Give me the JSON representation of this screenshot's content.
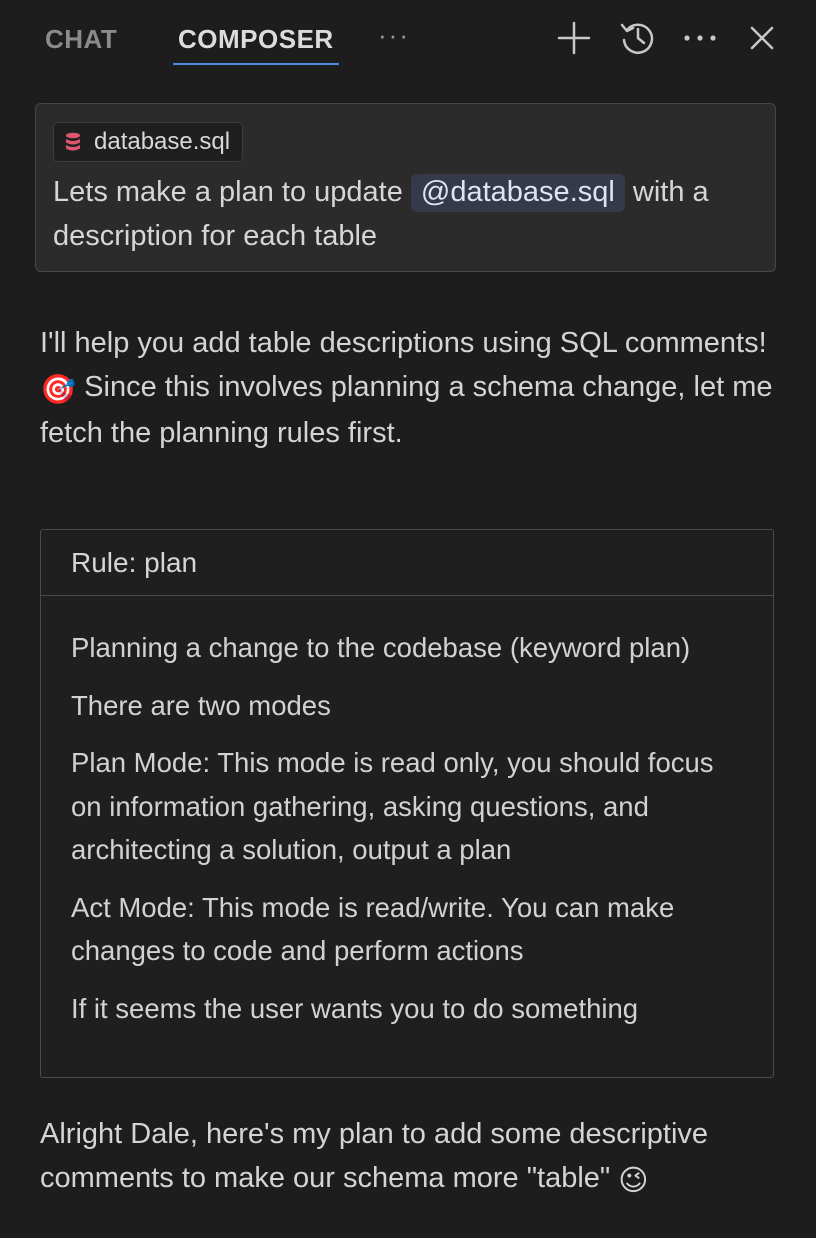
{
  "tabs": {
    "chat": "CHAT",
    "composer": "COMPOSER",
    "more": "···"
  },
  "toolbar": {
    "new_icon": "plus-icon",
    "history_icon": "history-icon",
    "more_icon": "ellipsis-icon",
    "close_icon": "close-icon"
  },
  "user_message": {
    "file_chip": "database.sql",
    "text_before": "Lets make a plan to update ",
    "mention": "@database.sql",
    "text_after": " with a description for each table"
  },
  "assistant": {
    "intro_part1": "I'll help you add table descriptions using SQL comments! ",
    "intro_emoji": "🎯",
    "intro_part2": " Since this involves planning a schema change, let me fetch the planning rules first.",
    "followup_text": "Alright Dale, here's my plan to add some descriptive comments to make our schema more \"table\" ",
    "followup_emoji": "😉"
  },
  "rule": {
    "title": "Rule: plan",
    "lines": [
      "Planning a change to the codebase (keyword plan)",
      "There are two modes",
      "Plan Mode: This mode is read only, you should focus on information gathering, asking questions, and architecting a solution, output a plan",
      "Act Mode: This mode is read/write. You can make changes to code and perform actions",
      "If it seems the user wants you to do something"
    ]
  },
  "colors": {
    "background": "#1d1d1e",
    "accent": "#4d8bde",
    "file_icon": "#e0566e",
    "mention_bg": "#35394a"
  }
}
